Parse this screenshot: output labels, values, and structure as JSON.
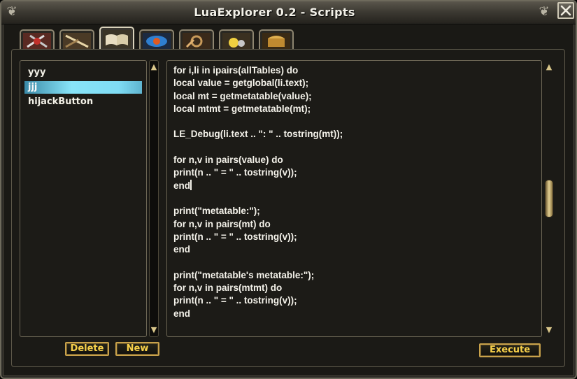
{
  "window": {
    "title": "LuaExplorer 0.2 - Scripts"
  },
  "tabs": [
    {
      "icon": "red-crossed-weapons-icon",
      "active": false
    },
    {
      "icon": "crossed-swords-icon",
      "active": false
    },
    {
      "icon": "open-book-icon",
      "active": true
    },
    {
      "icon": "blue-eye-orb-icon",
      "active": false
    },
    {
      "icon": "wrench-gears-icon",
      "active": false
    },
    {
      "icon": "potion-bottles-icon",
      "active": false
    },
    {
      "icon": "golden-chest-icon",
      "active": false
    }
  ],
  "script_list": {
    "items": [
      "yyy",
      "jjj",
      "hijackButton"
    ],
    "selected": "jjj"
  },
  "editor": {
    "lines_before_caret": "for i,li in ipairs(allTables) do\nlocal value = getglobal(li.text);\nlocal mt = getmetatable(value);\nlocal mtmt = getmetatable(mt);\n\nLE_Debug(li.text .. \": \" .. tostring(mt));\n\nfor n,v in pairs(value) do\nprint(n .. \" = \" .. tostring(v));\nend",
    "lines_after_caret": "\n\nprint(\"metatable:\");\nfor n,v in pairs(mt) do\nprint(n .. \" = \" .. tostring(v));\nend\n\nprint(\"metatable's metatable:\");\nfor n,v in pairs(mtmt) do\nprint(n .. \" = \" .. tostring(v));\nend"
  },
  "buttons": {
    "delete": "Delete",
    "new": "New",
    "execute": "Execute"
  },
  "colors": {
    "button_text": "#f7d04a",
    "selection": "#7fdcf4",
    "code_text": "#f4f2ea"
  }
}
